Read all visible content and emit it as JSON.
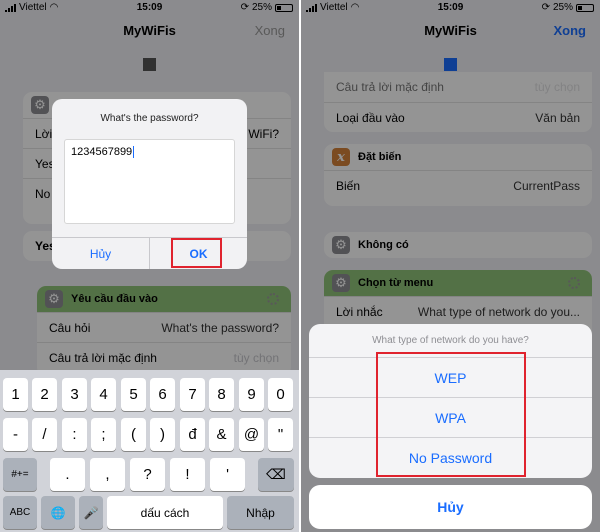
{
  "colors": {
    "ios_blue": "#1a6dff",
    "highlight_red": "#e0232e",
    "action_green": "#8fc379",
    "variable_orange": "#d4823a"
  },
  "left": {
    "status": {
      "carrier": "Viettel",
      "time": "15:09",
      "battery": "25%"
    },
    "nav": {
      "title": "MyWiFis",
      "done": "Xong"
    },
    "bg_card1": {
      "label_partial": "Lời",
      "question_partial": "WiFi?",
      "item_yes": "Yes",
      "item_no": "No"
    },
    "bg_card2": {
      "label_partial": "Yes"
    },
    "input_card": {
      "title": "Yêu cầu đầu vào",
      "row1": {
        "label": "Câu hỏi",
        "value": "What's the password?"
      },
      "row2": {
        "label": "Câu trả lời mặc định",
        "value": "tùy chọn"
      }
    },
    "alert": {
      "title": "What's the password?",
      "value": "1234567899",
      "cancel": "Hủy",
      "ok": "OK"
    },
    "keyboard": {
      "row1": [
        "1",
        "2",
        "3",
        "4",
        "5",
        "6",
        "7",
        "8",
        "9",
        "0"
      ],
      "row2": [
        "-",
        "/",
        ":",
        ";",
        "(",
        ")",
        "đ",
        "&",
        "@",
        "\""
      ],
      "row3": [
        "#+=",
        ".",
        ",",
        "?",
        "!",
        "'",
        "⌫"
      ],
      "row4": [
        "ABC",
        "🌐",
        "🎤",
        "dấu cách",
        "Nhập"
      ]
    }
  },
  "right": {
    "status": {
      "carrier": "Viettel",
      "time": "15:09",
      "battery": "25%"
    },
    "nav": {
      "title": "MyWiFis",
      "done": "Xong"
    },
    "card_input": {
      "row_default": {
        "label": "Câu trả lời mặc định",
        "value": "tùy chọn"
      },
      "row_type": {
        "label": "Loại đầu vào",
        "value": "Văn bản"
      }
    },
    "card_set_var": {
      "title": "Đặt biến",
      "icon": "x",
      "row": {
        "label": "Biến",
        "value": "CurrentPass"
      }
    },
    "card_otherwise": {
      "title": "Không có"
    },
    "card_menu": {
      "title": "Chọn từ menu",
      "row": {
        "label": "Lời nhắc",
        "value": "What type of network do you..."
      }
    },
    "sheet": {
      "title": "What type of network do you have?",
      "options": [
        "WEP",
        "WPA",
        "No Password"
      ],
      "cancel": "Hủy"
    }
  }
}
